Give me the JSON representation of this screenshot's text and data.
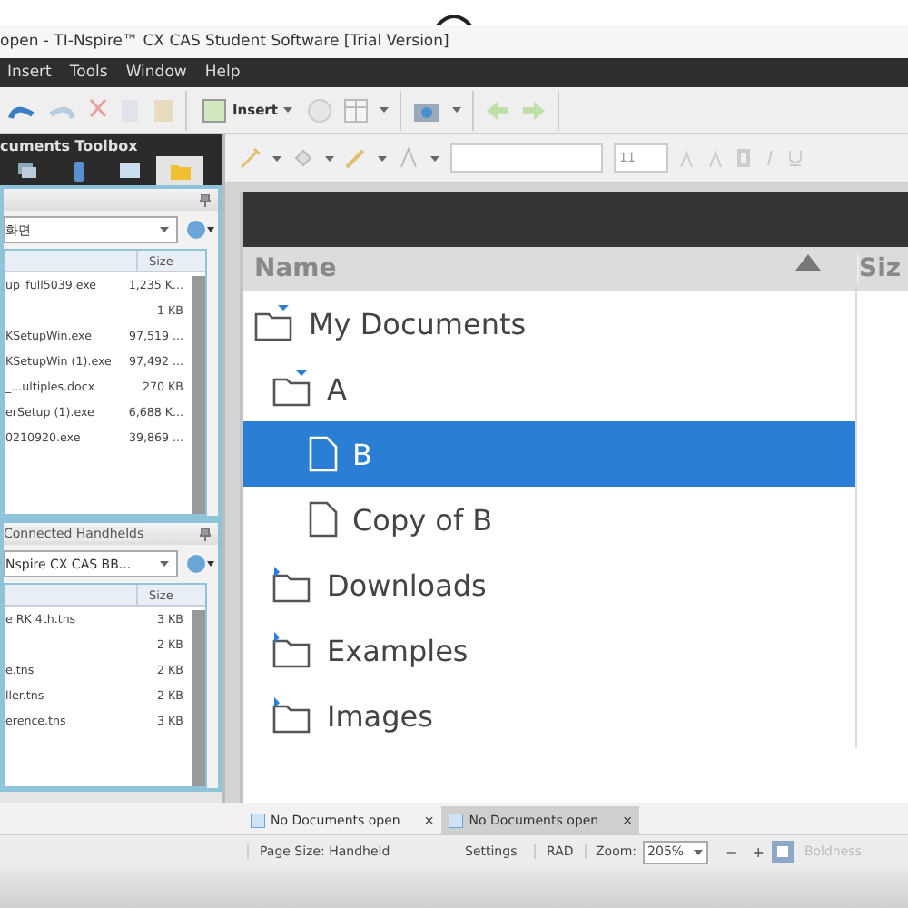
{
  "window": {
    "title": "open - TI-Nspire™ CX CAS Student Software [Trial Version]"
  },
  "menu": [
    "Insert",
    "Tools",
    "Window",
    "Help"
  ],
  "toolbar": {
    "insert_label": "Insert"
  },
  "toolbox": {
    "title": "cuments Toolbox",
    "tabs": [
      {
        "kind": "pages",
        "selected": false
      },
      {
        "kind": "handheld",
        "selected": false
      },
      {
        "kind": "mail",
        "selected": false
      },
      {
        "kind": "folder",
        "selected": true
      }
    ],
    "computer": {
      "location": "화면",
      "size_column": "Size",
      "rows": [
        {
          "name": "up_full5039.exe",
          "size": "1,235 K..."
        },
        {
          "name": "",
          "size": "1 KB"
        },
        {
          "name": "KSetupWin.exe",
          "size": "97,519 ..."
        },
        {
          "name": "KSetupWin (1).exe",
          "size": "97,492 ..."
        },
        {
          "name": "_...ultiples.docx",
          "size": "270 KB"
        },
        {
          "name": "erSetup (1).exe",
          "size": "6,688 K..."
        },
        {
          "name": "0210920.exe",
          "size": "39,869 ..."
        }
      ]
    },
    "handhelds": {
      "title": "Connected Handhelds",
      "device": "Nspire CX CAS BB...",
      "size_column": "Size",
      "rows": [
        {
          "name": "e RK 4th.tns",
          "size": "3 KB"
        },
        {
          "name": "",
          "size": "2 KB"
        },
        {
          "name": "e.tns",
          "size": "2 KB"
        },
        {
          "name": "ller.tns",
          "size": "2 KB"
        },
        {
          "name": "erence.tns",
          "size": "3 KB"
        }
      ]
    }
  },
  "format_toolbar": {
    "font_size": "11"
  },
  "browser": {
    "columns": [
      "Name",
      "Siz"
    ],
    "items": [
      {
        "name": "My Documents",
        "kind": "folder",
        "expanded": true,
        "selected": false,
        "children": [
          {
            "name": "A",
            "kind": "folder",
            "expanded": true,
            "selected": false,
            "children": [
              {
                "name": "B",
                "kind": "file",
                "selected": true
              },
              {
                "name": "Copy of B",
                "kind": "file",
                "selected": false
              }
            ]
          },
          {
            "name": "Downloads",
            "kind": "folder",
            "expanded": false,
            "selected": false
          },
          {
            "name": "Examples",
            "kind": "folder",
            "expanded": false,
            "selected": false
          },
          {
            "name": "Images",
            "kind": "folder",
            "expanded": false,
            "selected": false
          }
        ]
      }
    ]
  },
  "doc_tabs": [
    {
      "label": "No Documents open",
      "close": "×",
      "selected": false
    },
    {
      "label": "No Documents open",
      "close": "×",
      "selected": true
    }
  ],
  "status_bar": {
    "page_size": "Page Size: Handheld",
    "settings": "Settings",
    "angle": "RAD",
    "zoom_label": "Zoom:",
    "zoom": "205%",
    "zoom_out": "−",
    "zoom_in": "+",
    "boldness": "Boldness:"
  }
}
